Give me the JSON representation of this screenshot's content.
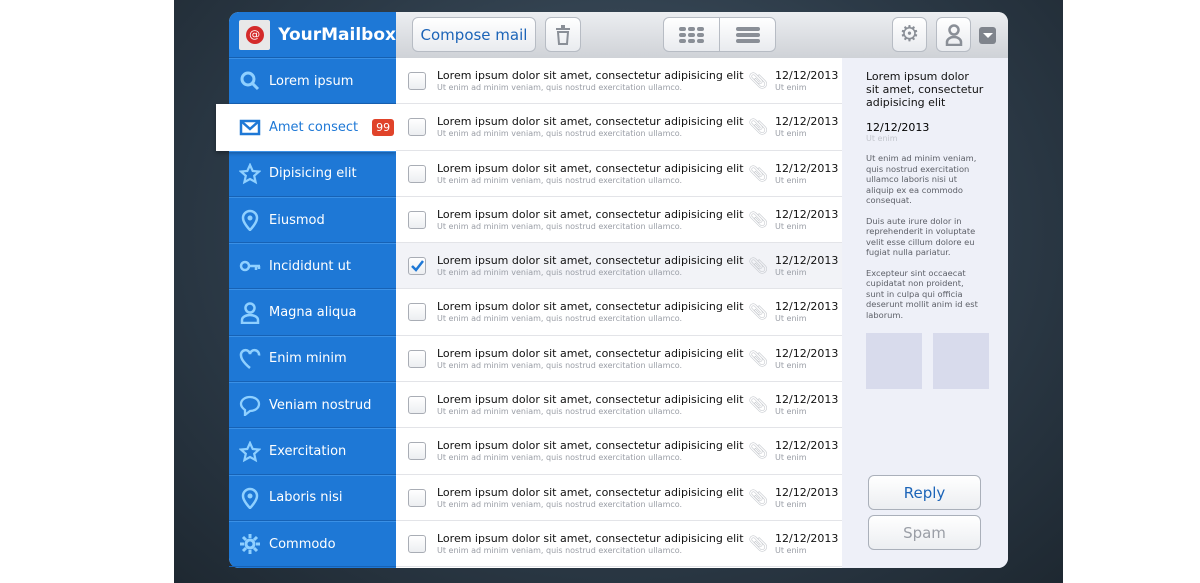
{
  "app": {
    "title": "YourMailbox",
    "logo_glyph": "@"
  },
  "toolbar": {
    "compose_label": "Compose mail",
    "icons": [
      "trash-icon",
      "grid-view-icon",
      "list-view-icon",
      "gear-icon",
      "user-icon",
      "dropdown-icon"
    ]
  },
  "sidebar": {
    "items": [
      {
        "label": "Lorem ipsum",
        "icon": "search"
      },
      {
        "label": "Amet consect",
        "icon": "mail",
        "badge": "99",
        "active": true
      },
      {
        "label": "Dipisicing elit",
        "icon": "star"
      },
      {
        "label": "Eiusmod",
        "icon": "pin"
      },
      {
        "label": "Incididunt ut",
        "icon": "key"
      },
      {
        "label": "Magna aliqua",
        "icon": "user"
      },
      {
        "label": "Enim minim",
        "icon": "heart"
      },
      {
        "label": "Veniam nostrud",
        "icon": "chat"
      },
      {
        "label": "Exercitation",
        "icon": "star"
      },
      {
        "label": "Laboris nisi",
        "icon": "pin"
      },
      {
        "label": "Commodo",
        "icon": "gear"
      }
    ]
  },
  "messages": [
    {
      "subject": "Lorem ipsum dolor sit amet, consectetur adipisicing elit",
      "preview": "Ut enim ad minim veniam, quis nostrud exercitation ullamco.",
      "date": "12/12/2013",
      "sub": "Ut enim",
      "checked": false
    },
    {
      "subject": "Lorem ipsum dolor sit amet, consectetur adipisicing elit",
      "preview": "Ut enim ad minim veniam, quis nostrud exercitation ullamco.",
      "date": "12/12/2013",
      "sub": "Ut enim",
      "checked": false
    },
    {
      "subject": "Lorem ipsum dolor sit amet, consectetur adipisicing elit",
      "preview": "Ut enim ad minim veniam, quis nostrud exercitation ullamco.",
      "date": "12/12/2013",
      "sub": "Ut enim",
      "checked": false
    },
    {
      "subject": "Lorem ipsum dolor sit amet, consectetur adipisicing elit",
      "preview": "Ut enim ad minim veniam, quis nostrud exercitation ullamco.",
      "date": "12/12/2013",
      "sub": "Ut enim",
      "checked": false
    },
    {
      "subject": "Lorem ipsum dolor sit amet, consectetur adipisicing elit",
      "preview": "Ut enim ad minim veniam, quis nostrud exercitation ullamco.",
      "date": "12/12/2013",
      "sub": "Ut enim",
      "checked": true
    },
    {
      "subject": "Lorem ipsum dolor sit amet, consectetur adipisicing elit",
      "preview": "Ut enim ad minim veniam, quis nostrud exercitation ullamco.",
      "date": "12/12/2013",
      "sub": "Ut enim",
      "checked": false
    },
    {
      "subject": "Lorem ipsum dolor sit amet, consectetur adipisicing elit",
      "preview": "Ut enim ad minim veniam, quis nostrud exercitation ullamco.",
      "date": "12/12/2013",
      "sub": "Ut enim",
      "checked": false
    },
    {
      "subject": "Lorem ipsum dolor sit amet, consectetur adipisicing elit",
      "preview": "Ut enim ad minim veniam, quis nostrud exercitation ullamco.",
      "date": "12/12/2013",
      "sub": "Ut enim",
      "checked": false
    },
    {
      "subject": "Lorem ipsum dolor sit amet, consectetur adipisicing elit",
      "preview": "Ut enim ad minim veniam, quis nostrud exercitation ullamco.",
      "date": "12/12/2013",
      "sub": "Ut enim",
      "checked": false
    },
    {
      "subject": "Lorem ipsum dolor sit amet, consectetur adipisicing elit",
      "preview": "Ut enim ad minim veniam, quis nostrud exercitation ullamco.",
      "date": "12/12/2013",
      "sub": "Ut enim",
      "checked": false
    },
    {
      "subject": "Lorem ipsum dolor sit amet, consectetur adipisicing elit",
      "preview": "Ut enim ad minim veniam, quis nostrud exercitation ullamco.",
      "date": "12/12/2013",
      "sub": "Ut enim",
      "checked": false
    }
  ],
  "reader": {
    "title": "Lorem ipsum dolor sit amet, consectetur adipisicing elit",
    "date": "12/12/2013",
    "sub": "Ut enim",
    "paragraphs": [
      "Ut enim ad minim veniam, quis nostrud exercitation ullamco laboris nisi ut aliquip ex ea commodo consequat.",
      "Duis aute irure dolor in reprehenderit in voluptate velit esse cillum dolore eu fugiat nulla pariatur.",
      "Excepteur sint occaecat cupidatat non proident, sunt in culpa qui officia deserunt mollit anim id est laborum."
    ],
    "reply_label": "Reply",
    "spam_label": "Spam"
  },
  "colors": {
    "accent": "#1e78d6",
    "badge": "#e0432a"
  }
}
